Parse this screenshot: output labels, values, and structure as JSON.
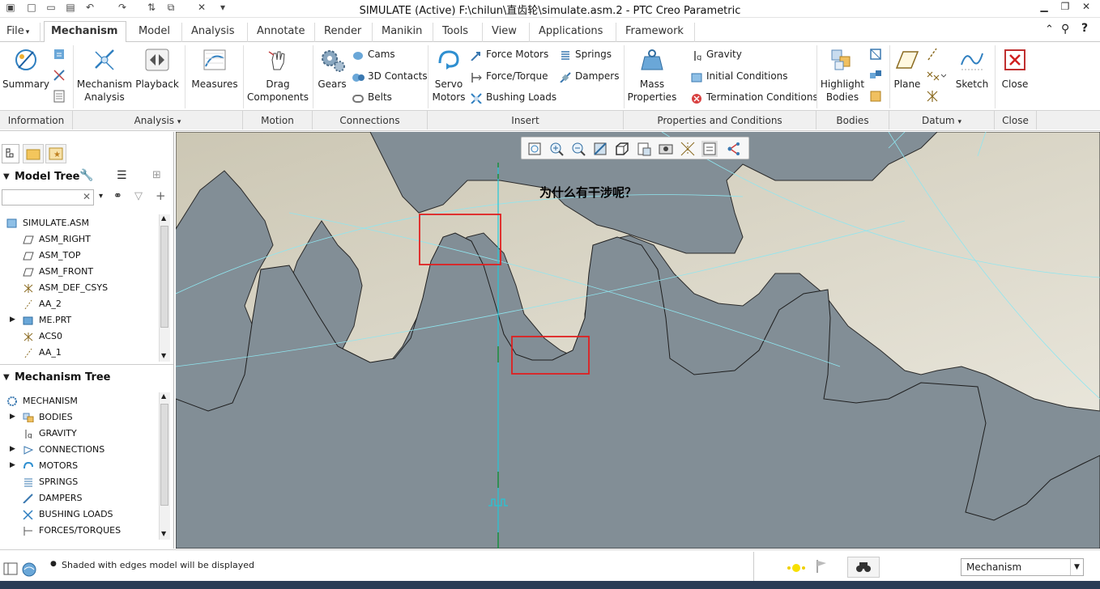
{
  "window": {
    "title": "SIMULATE (Active) F:\\chilun\\直齿轮\\simulate.asm.2 - PTC Creo Parametric"
  },
  "tabs": [
    {
      "label": "File",
      "arrow": "▾"
    },
    {
      "label": "Mechanism"
    },
    {
      "label": "Model"
    },
    {
      "label": "Analysis"
    },
    {
      "label": "Annotate"
    },
    {
      "label": "Render"
    },
    {
      "label": "Manikin"
    },
    {
      "label": "Tools"
    },
    {
      "label": "View"
    },
    {
      "label": "Applications"
    },
    {
      "label": "Framework"
    }
  ],
  "ribbon": {
    "summary": "Summary",
    "mech_analysis_l1": "Mechanism",
    "mech_analysis_l2": "Analysis",
    "playback": "Playback",
    "measures": "Measures",
    "drag_l1": "Drag",
    "drag_l2": "Components",
    "gears": "Gears",
    "cams": "Cams",
    "contacts3d": "3D Contacts",
    "belts": "Belts",
    "servo_l1": "Servo",
    "servo_l2": "Motors",
    "force_motors": "Force Motors",
    "force_torque": "Force/Torque",
    "bushing_loads": "Bushing Loads",
    "springs": "Springs",
    "dampers": "Dampers",
    "mass_l1": "Mass",
    "mass_l2": "Properties",
    "gravity": "Gravity",
    "initial_conditions": "Initial Conditions",
    "termination_conditions": "Termination Conditions",
    "highlight_l1": "Highlight",
    "highlight_l2": "Bodies",
    "plane": "Plane",
    "sketch": "Sketch",
    "close": "Close"
  },
  "groups": {
    "information": "Information",
    "analysis": "Analysis",
    "motion": "Motion",
    "connections": "Connections",
    "insert": "Insert",
    "properties": "Properties and Conditions",
    "bodies": "Bodies",
    "datum": "Datum",
    "close": "Close",
    "dropdown_arrow": "▾"
  },
  "model_tree": {
    "title": "Model Tree",
    "items": [
      "SIMULATE.ASM",
      "ASM_RIGHT",
      "ASM_TOP",
      "ASM_FRONT",
      "ASM_DEF_CSYS",
      "AA_2",
      "ME.PRT",
      "ACS0",
      "AA_1"
    ]
  },
  "mechanism_tree": {
    "title": "Mechanism Tree",
    "items": [
      "MECHANISM",
      "BODIES",
      "GRAVITY",
      "CONNECTIONS",
      "MOTORS",
      "SPRINGS",
      "DAMPERS",
      "BUSHING LOADS",
      "FORCES/TORQUES"
    ]
  },
  "viewport": {
    "annotation": "为什么有干涉呢？"
  },
  "status": {
    "message": "Shaded with edges model will be displayed",
    "mode_select": "Mechanism"
  },
  "colors": {
    "viewport_bg": "#828e96",
    "gear_face": "#d9d5c7",
    "highlight_box": "#e02020",
    "axis_line": "#22c8d8"
  }
}
